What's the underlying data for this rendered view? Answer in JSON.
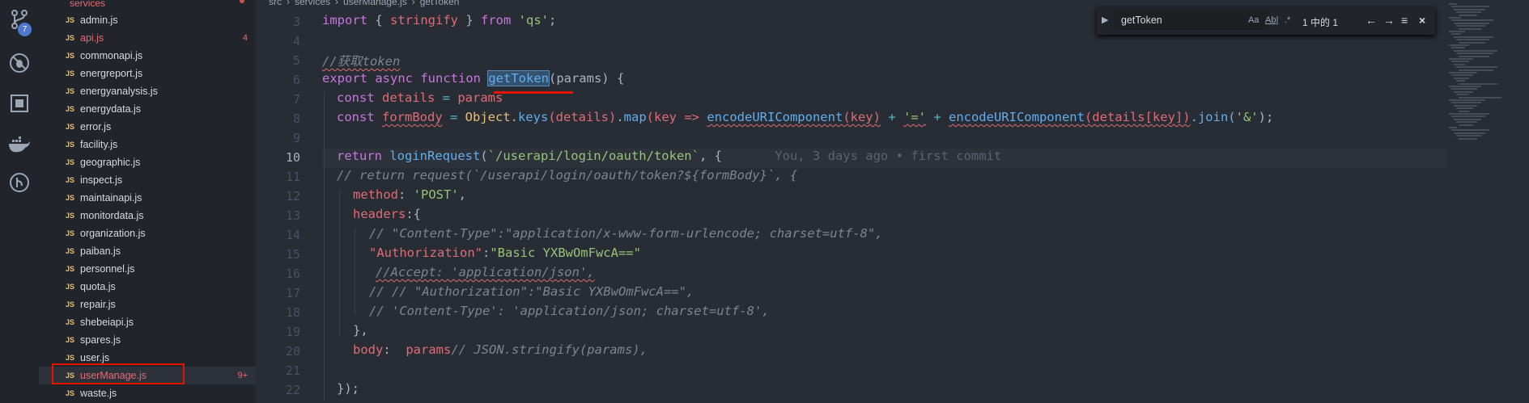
{
  "activity": {
    "badge_count": "7"
  },
  "explorer": {
    "folder": "services",
    "files": [
      {
        "name": "admin.js",
        "badge": ""
      },
      {
        "name": "api.js",
        "badge": "4",
        "error": true
      },
      {
        "name": "commonapi.js",
        "badge": ""
      },
      {
        "name": "energreport.js",
        "badge": ""
      },
      {
        "name": "energyanalysis.js",
        "badge": ""
      },
      {
        "name": "energydata.js",
        "badge": ""
      },
      {
        "name": "error.js",
        "badge": ""
      },
      {
        "name": "facility.js",
        "badge": ""
      },
      {
        "name": "geographic.js",
        "badge": ""
      },
      {
        "name": "inspect.js",
        "badge": ""
      },
      {
        "name": "maintainapi.js",
        "badge": ""
      },
      {
        "name": "monitordata.js",
        "badge": ""
      },
      {
        "name": "organization.js",
        "badge": ""
      },
      {
        "name": "paiban.js",
        "badge": ""
      },
      {
        "name": "personnel.js",
        "badge": ""
      },
      {
        "name": "quota.js",
        "badge": ""
      },
      {
        "name": "repair.js",
        "badge": ""
      },
      {
        "name": "shebeiapi.js",
        "badge": ""
      },
      {
        "name": "spares.js",
        "badge": ""
      },
      {
        "name": "user.js",
        "badge": ""
      },
      {
        "name": "userManage.js",
        "badge": "9+",
        "error": true,
        "selected": true
      },
      {
        "name": "waste.js",
        "badge": ""
      }
    ]
  },
  "breadcrumb": {
    "root": "src",
    "sep": "›",
    "folder": "services",
    "file": "userManage.js",
    "symbol": "getToken"
  },
  "find": {
    "query": "getToken",
    "match_case": "Aa",
    "whole_word": "Ab|",
    "regex": ".*",
    "count": "1 中的 1",
    "prev": "←",
    "next": "→",
    "selection": "≡",
    "close": "×"
  },
  "editor": {
    "line_numbers": [
      "3",
      "4",
      "5",
      "6",
      "7",
      "8",
      "9",
      "10",
      "11",
      "12",
      "13",
      "14",
      "15",
      "16",
      "17",
      "18",
      "19",
      "20",
      "21",
      "22"
    ],
    "blame": "You, 3 days ago • first commit",
    "t": {
      "import": "import",
      "brace_open": " { ",
      "stringify": "stringify",
      "brace_close": " } ",
      "from": "from",
      "qs": " 'qs'",
      "semi": ";",
      "comment_token": "//获取token",
      "export": "export",
      "async": " async",
      "function": " function ",
      "getToken": "getToken",
      "params_decl": "(params) {",
      "const": "const ",
      "details": "details",
      "eq": " = ",
      "params": "params",
      "formBody": "formBody",
      "Object": "Object",
      "dot": ".",
      "keys": "keys",
      "p_details": "(details)",
      "map": "map",
      "key_arrow": "(key => ",
      "encode": "encodeURIComponent",
      "key_arg": "(key)",
      "plus": " + ",
      "eqstr": "'='",
      "details_key": "(details[key])",
      "join": ".join(",
      "amp": "'&'",
      "end": ");",
      "return": "return ",
      "loginRequest": "loginRequest",
      "url": "`/userapi/login/oauth/token`",
      "comma_brace": ", {",
      "c11": "// return request(`/userapi/login/oauth/token?${formBody}`, {",
      "method": "method",
      "colon": ": ",
      "post": "'POST'",
      "comma": ",",
      "headers": "headers",
      "colon_brace": ":{",
      "c14": "// \"Content-Type\":\"application/x-www-form-urlencode; charset=utf-8\",",
      "auth_key": "\"Authorization\"",
      "colon2": ":",
      "auth_val": "\"Basic YXBwOmFwcA==\"",
      "c16": "//Accept: 'application/json',",
      "c17": "// // \"Authorization\":\"Basic YXBwOmFwcA==\",",
      "c18": "// 'Content-Type': 'application/json; charset=utf-8',",
      "close_brace_comma": "},",
      "body": "body",
      "colon_sp": ":  ",
      "c20": "// JSON.stringify(params),",
      "final": "});"
    }
  }
}
